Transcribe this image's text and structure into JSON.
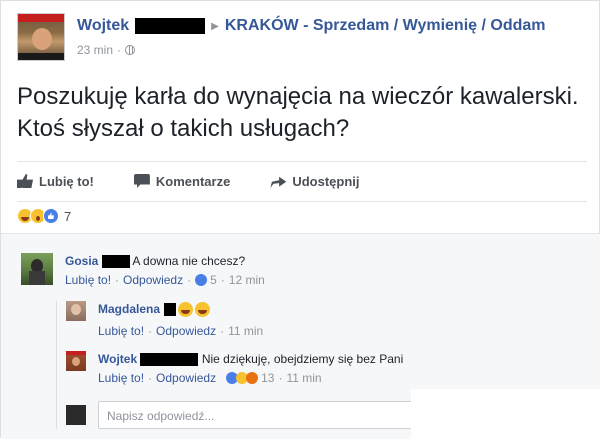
{
  "post": {
    "author": "Wojtek",
    "group": "KRAKÓW - Sprzedam / Wymienię / Oddam",
    "time": "23 min",
    "text": "Poszukuję karła do wynajęcia na wieczór kawalerski. Ktoś słyszał o takich usługach?"
  },
  "actions": {
    "like": "Lubię to!",
    "comment": "Komentarze",
    "share": "Udostępnij"
  },
  "reactions": {
    "icons": [
      "haha-icon",
      "wow-icon",
      "like-icon"
    ],
    "count": "7"
  },
  "comments": [
    {
      "name": "Gosia",
      "text": "A downa nie chcesz?",
      "like": "Lubię to!",
      "reply": "Odpowiedz",
      "react_count": "5",
      "time": "12 min"
    },
    {
      "name": "Magdalena",
      "text": "",
      "like": "Lubię to!",
      "reply": "Odpowiedz",
      "time": "11 min"
    },
    {
      "name": "Wojtek",
      "text": "Nie dziękuję, obejdziemy się bez Pani",
      "like": "Lubię to!",
      "reply": "Odpowiedz",
      "react_count": "13",
      "time": "11 min"
    }
  ],
  "reply_box": {
    "placeholder": "Napisz odpowiedź..."
  },
  "colors": {
    "link": "#365899",
    "text": "#1d2129",
    "meta": "#90949c"
  }
}
